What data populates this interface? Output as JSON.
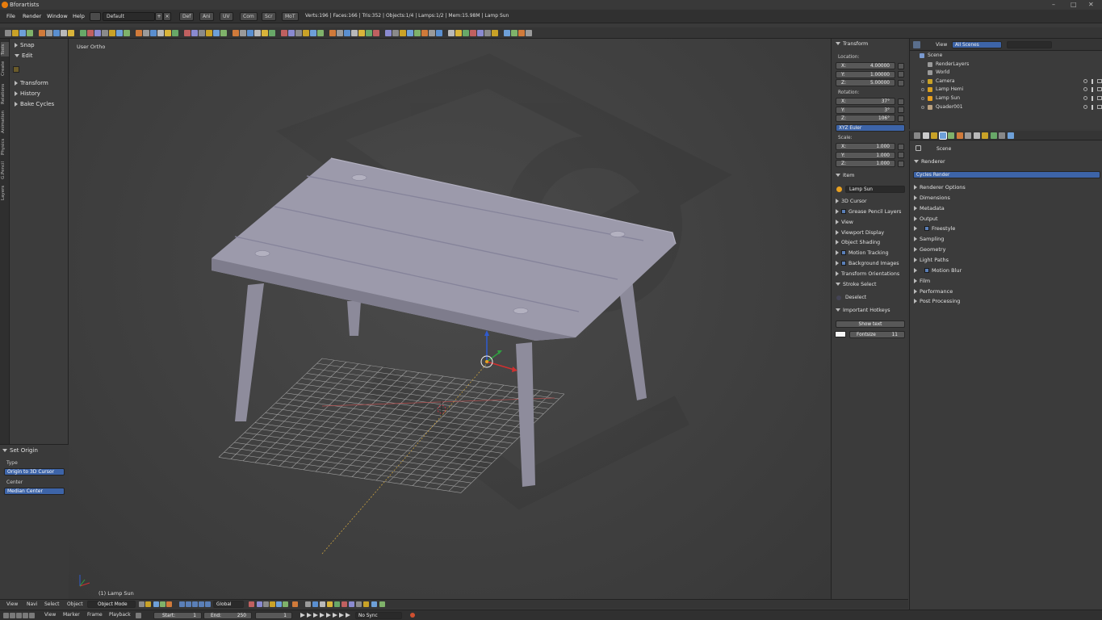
{
  "window": {
    "title": "Bforartists",
    "minimize": "–",
    "maximize": "□",
    "close": "✕"
  },
  "menubar": {
    "items": [
      "File",
      "Render",
      "Window",
      "Help"
    ],
    "screen_layout": "Default",
    "workspace_tabs": [
      "Def",
      "Ani",
      "UV",
      "Com",
      "Scr",
      "MoT"
    ],
    "stats": "Verts:196 | Faces:166 | Tris:352 | Objects:1/4 | Lamps:1/2 | Mem:15.98M | Lamp Sun"
  },
  "vertical_tabs": [
    "Tools",
    "Create",
    "Relations",
    "Animation",
    "Physics",
    "G.Pencil",
    "Layers"
  ],
  "tool_shelf": {
    "sections": [
      {
        "label": "Snap",
        "open": false
      },
      {
        "label": "Edit",
        "open": true
      },
      {
        "label": "Transform",
        "open": false
      },
      {
        "label": "History",
        "open": false
      },
      {
        "label": "Bake Cycles",
        "open": false
      }
    ],
    "operator": {
      "title": "Set Origin",
      "type_label": "Type",
      "type_value": "Origin to 3D Cursor",
      "center_label": "Center",
      "center_value": "Median Center"
    }
  },
  "viewport": {
    "view_name": "User Ortho",
    "object_label": "(1) Lamp Sun"
  },
  "npanel": {
    "transform_title": "Transform",
    "location_label": "Location:",
    "location": [
      {
        "axis": "X:",
        "value": "4.00000"
      },
      {
        "axis": "Y:",
        "value": "1.00000"
      },
      {
        "axis": "Z:",
        "value": "5.00000"
      }
    ],
    "rotation_label": "Rotation:",
    "rotation": [
      {
        "axis": "X:",
        "value": "37°"
      },
      {
        "axis": "Y:",
        "value": "3°"
      },
      {
        "axis": "Z:",
        "value": "106°"
      }
    ],
    "rotation_mode": "XYZ Euler",
    "scale_label": "Scale:",
    "scale": [
      {
        "axis": "X:",
        "value": "1.000"
      },
      {
        "axis": "Y:",
        "value": "1.000"
      },
      {
        "axis": "Z:",
        "value": "1.000"
      }
    ],
    "item_title": "Item",
    "item_name": "Lamp Sun",
    "sections": [
      {
        "label": "3D Cursor",
        "checkbox": false
      },
      {
        "label": "Grease Pencil Layers",
        "checkbox": true
      },
      {
        "label": "View",
        "checkbox": false
      },
      {
        "label": "Viewport Display",
        "checkbox": false
      },
      {
        "label": "Object Shading",
        "checkbox": false
      },
      {
        "label": "Motion Tracking",
        "checkbox": true
      },
      {
        "label": "Background Images",
        "checkbox": true
      },
      {
        "label": "Transform Orientations",
        "checkbox": false
      }
    ],
    "stroke_select_title": "Stroke Select",
    "deselect_label": "Deselect",
    "hotkeys_title": "Important Hotkeys",
    "show_text_label": "Show text",
    "fontsize_label": "Fontsize",
    "fontsize_value": "11"
  },
  "outliner": {
    "view_label": "View",
    "scene_filter": "All Scenes",
    "tree": [
      {
        "label": "Scene",
        "indent": 0
      },
      {
        "label": "RenderLayers",
        "indent": 1
      },
      {
        "label": "World",
        "indent": 1
      },
      {
        "label": "Camera",
        "indent": 1
      },
      {
        "label": "Lamp Hemi",
        "indent": 1
      },
      {
        "label": "Lamp Sun",
        "indent": 1
      },
      {
        "label": "Quader001",
        "indent": 1
      }
    ]
  },
  "properties": {
    "context": "Scene",
    "renderer_title": "Renderer",
    "render_engine": "Cycles Render",
    "panels": [
      {
        "label": "Renderer Options",
        "checkbox": false
      },
      {
        "label": "Dimensions",
        "checkbox": false
      },
      {
        "label": "Metadata",
        "checkbox": false
      },
      {
        "label": "Output",
        "checkbox": false
      },
      {
        "label": "Freestyle",
        "checkbox": true
      },
      {
        "label": "Sampling",
        "checkbox": false
      },
      {
        "label": "Geometry",
        "checkbox": false
      },
      {
        "label": "Light Paths",
        "checkbox": false
      },
      {
        "label": "Motion Blur",
        "checkbox": true
      },
      {
        "label": "Film",
        "checkbox": false
      },
      {
        "label": "Performance",
        "checkbox": false
      },
      {
        "label": "Post Processing",
        "checkbox": false
      }
    ]
  },
  "view_header": {
    "menus": [
      "View",
      "Navi",
      "Select",
      "Object"
    ],
    "mode": "Object Mode",
    "orientation": "Global"
  },
  "timeline": {
    "menus": [
      "View",
      "Marker",
      "Frame",
      "Playback"
    ],
    "start_label": "Start:",
    "start_value": "1",
    "end_label": "End:",
    "end_value": "250",
    "current_frame": "1",
    "sync": "No Sync"
  },
  "colors": {
    "accent": "#5a7fb8",
    "selected_blue": "#3d64a8",
    "background": "#3a3a3a"
  }
}
